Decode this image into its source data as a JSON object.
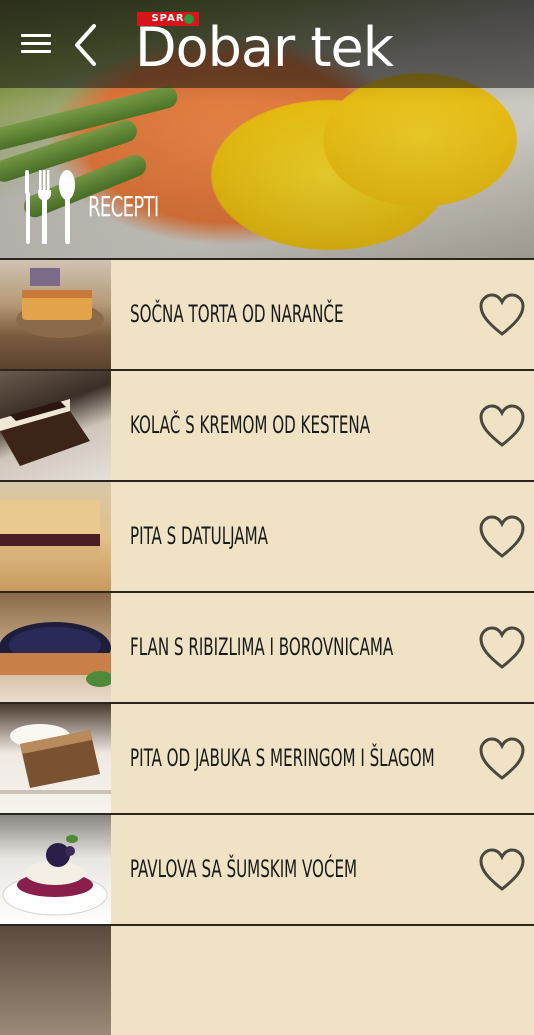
{
  "header": {
    "logo_brand": "SPAR",
    "logo_text": "Dobar tek",
    "menu_icon": "hamburger-menu-icon",
    "back_icon": "chevron-left-icon"
  },
  "section": {
    "label": "RECEPTI",
    "icon": "cutlery-icon"
  },
  "recipes": [
    {
      "title": "SOČNA TORTA OD NARANČE",
      "favorite_icon": "heart-outline-icon"
    },
    {
      "title": "KOLAČ S KREMOM OD KESTENA",
      "favorite_icon": "heart-outline-icon"
    },
    {
      "title": "PITA S DATULJAMA",
      "favorite_icon": "heart-outline-icon"
    },
    {
      "title": "FLAN S RIBIZLIMA I BOROVNICAMA",
      "favorite_icon": "heart-outline-icon"
    },
    {
      "title": "PITA OD JABUKA S MERINGOM I ŠLAGOM",
      "favorite_icon": "heart-outline-icon"
    },
    {
      "title": "PAVLOVA SA ŠUMSKIM VOĆEM",
      "favorite_icon": "heart-outline-icon"
    },
    {
      "title": "",
      "favorite_icon": ""
    }
  ],
  "colors": {
    "row_background": "#efe2c5",
    "row_divider": "#2a2520",
    "heart_stroke": "#4a4640",
    "spar_red": "#d7141a"
  }
}
